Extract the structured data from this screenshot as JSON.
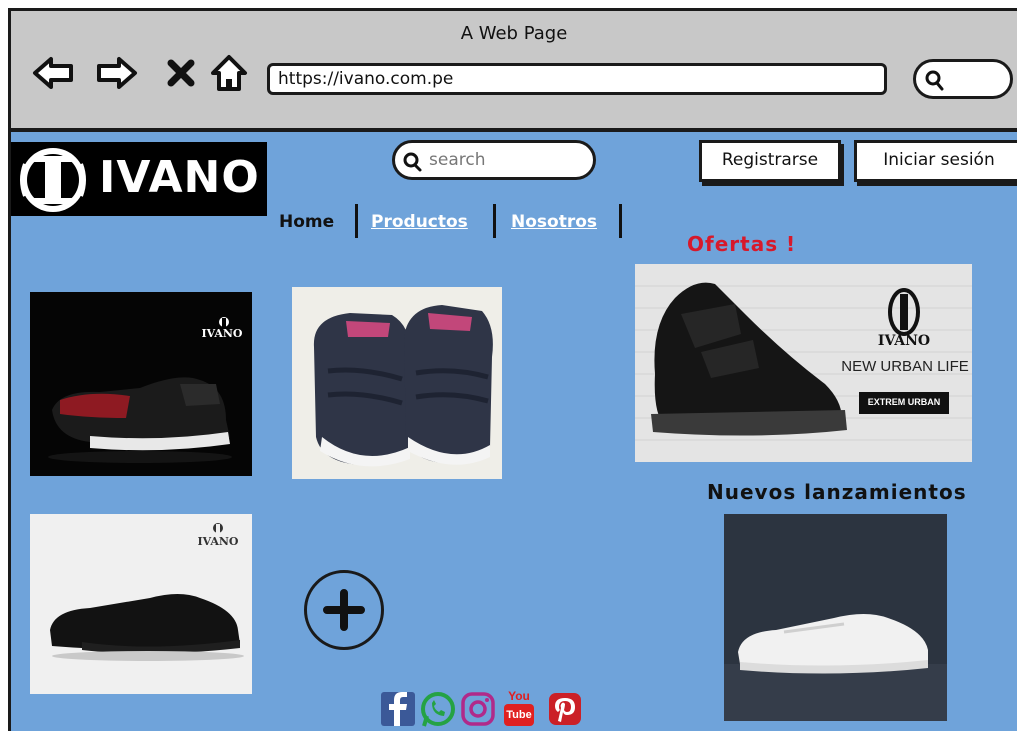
{
  "browser": {
    "title": "A Web Page",
    "url": "https://ivano.com.pe",
    "nav_icons": [
      "back-arrow-icon",
      "forward-arrow-icon",
      "close-icon",
      "home-icon"
    ],
    "search_icon": "search-icon"
  },
  "header": {
    "logo_text": "IVANO",
    "search_placeholder": "search",
    "register_label": "Registrarse",
    "login_label": "Iniciar sesión"
  },
  "menu": {
    "home": "Home",
    "productos": "Productos",
    "nosotros": "Nosotros"
  },
  "sections": {
    "ofertas": "Ofertas !",
    "nuevos": "Nuevos lanzamientos"
  },
  "products": {
    "brand_mark": "IVANO",
    "offer_brand": "IVANO",
    "offer_tagline": "NEW URBAN LIFE",
    "offer_badge": "EXTREM URBAN"
  },
  "social": [
    "facebook-icon",
    "whatsapp-icon",
    "instagram-icon",
    "youtube-icon",
    "pinterest-icon"
  ],
  "youtube_text_top": "You",
  "youtube_text_bottom": "Tube",
  "colors": {
    "page_bg": "#6fa3da",
    "browser_bar": "#c8c8c8",
    "ofertas_red": "#d7192b",
    "facebook": "#3b5998",
    "whatsapp": "#25a244",
    "youtube": "#e02020",
    "pinterest": "#cb2027"
  }
}
